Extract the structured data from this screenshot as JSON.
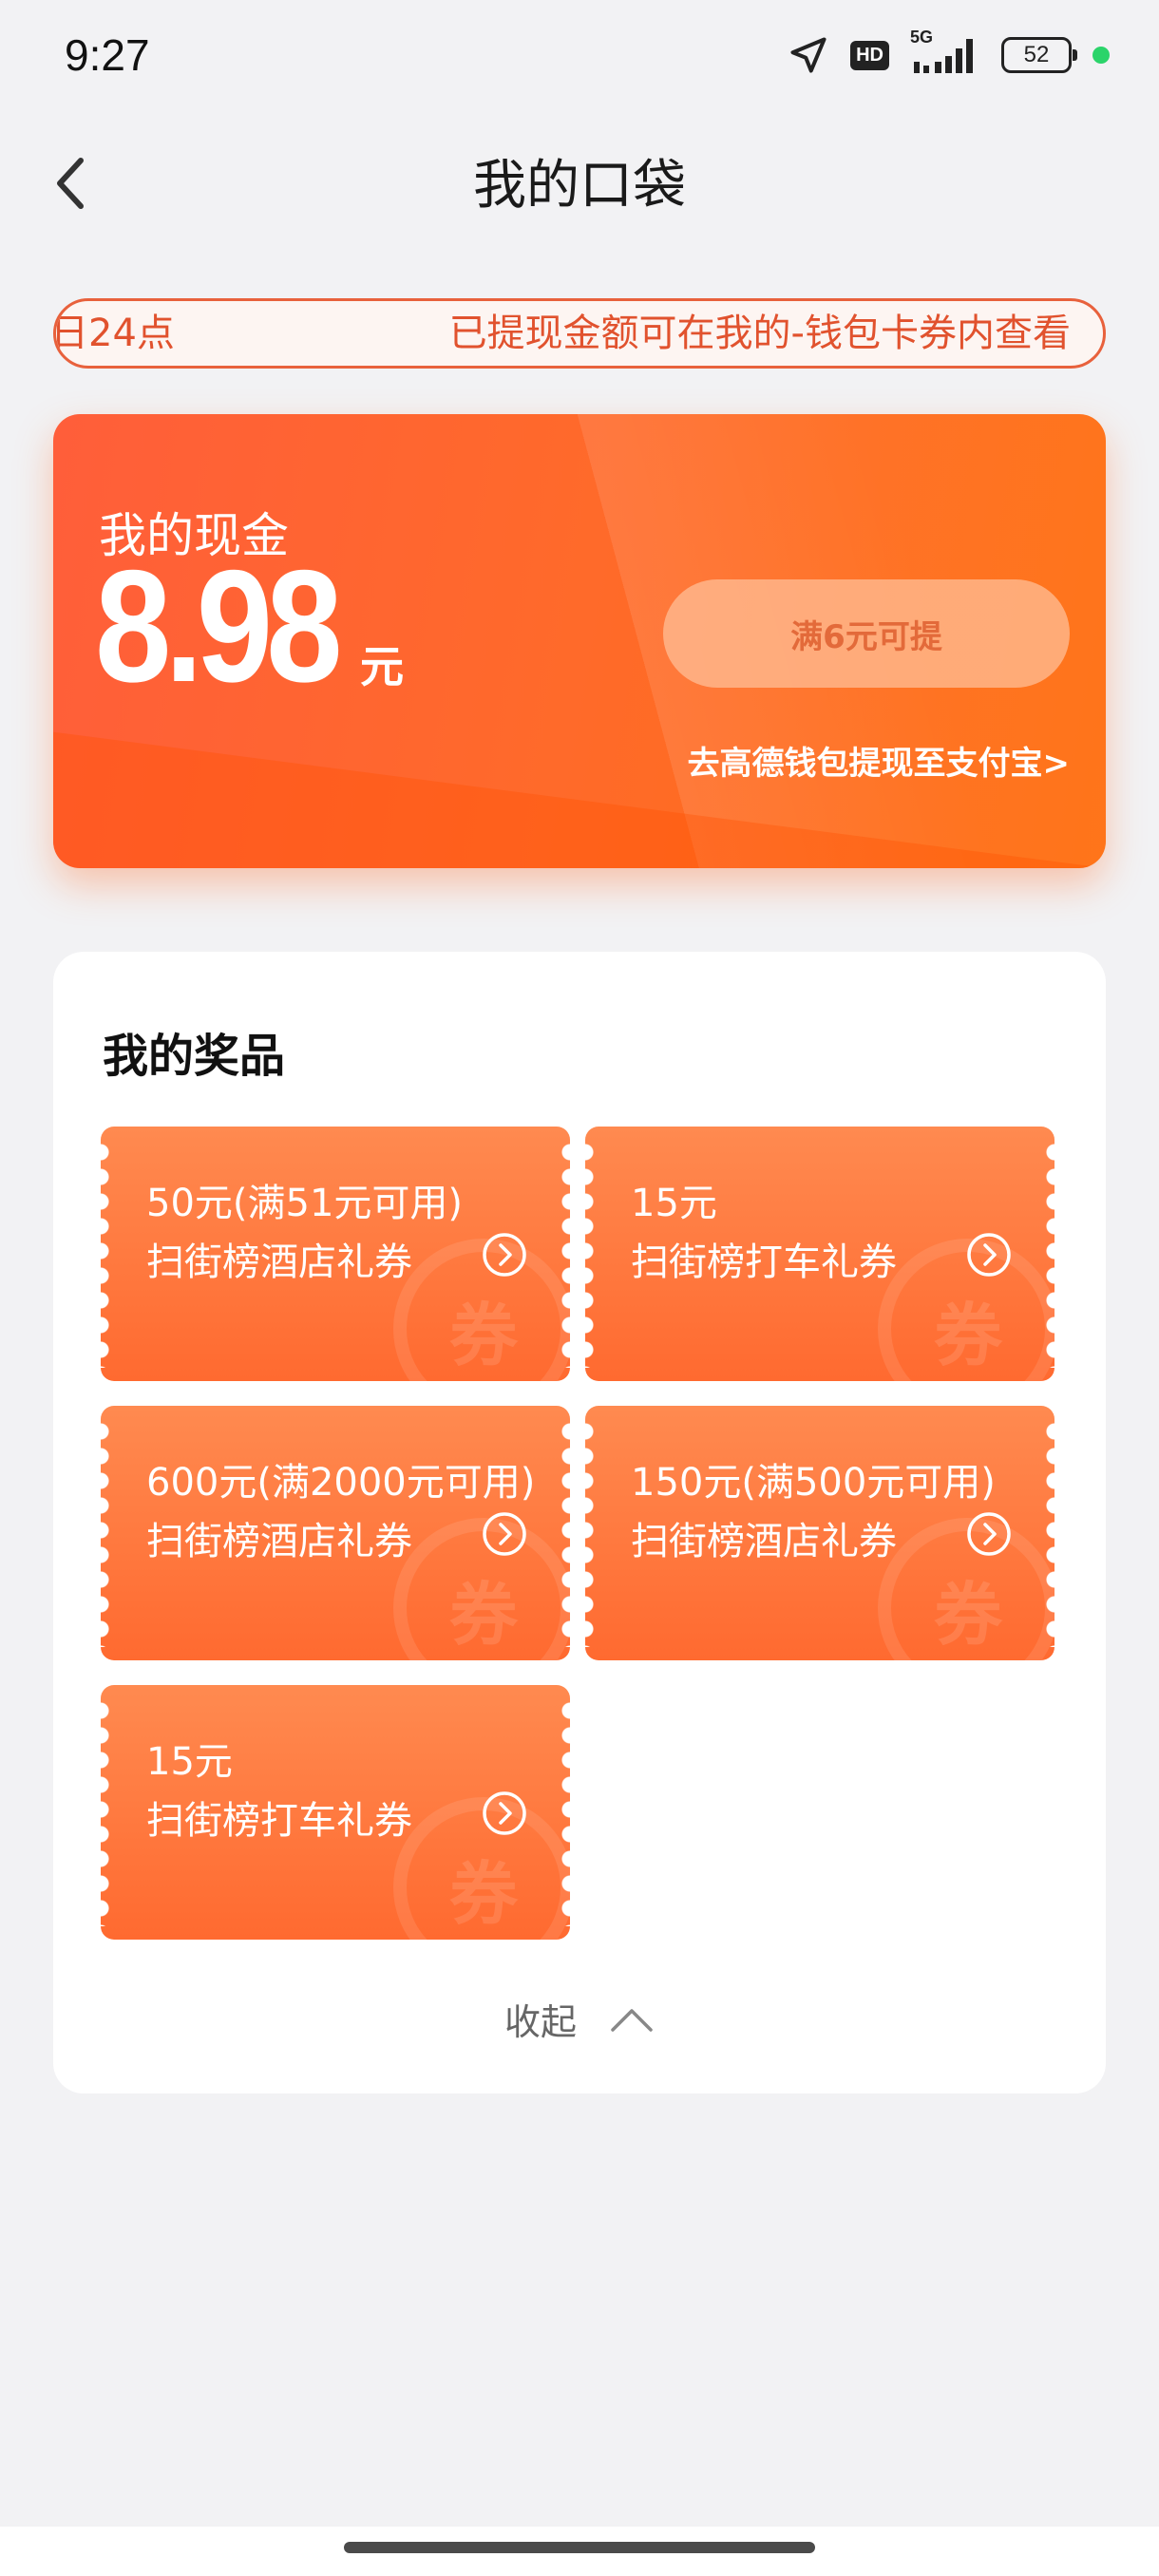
{
  "status_bar": {
    "time": "9:27",
    "network": "5G",
    "hd": "HD",
    "battery": "52",
    "icons": [
      "location-arrow-icon",
      "hd-badge-icon",
      "signal-icon",
      "battery-icon",
      "camera-dot-icon"
    ]
  },
  "nav": {
    "title": "我的口袋",
    "back_icon": "chevron-left-icon"
  },
  "notice": {
    "left_text": "日24点",
    "right_text": "已提现金额可在我的-钱包卡券内查看"
  },
  "cash": {
    "label": "我的现金",
    "amount": "8.98",
    "unit": "元",
    "button_label": "满6元可提",
    "link_label": "去高德钱包提现至支付宝>"
  },
  "prizes": {
    "title": "我的奖品",
    "coupons": [
      {
        "amount": "50元(满51元可用)",
        "name": "扫街榜酒店礼券",
        "watermark": "券"
      },
      {
        "amount": "15元",
        "name": "扫街榜打车礼券",
        "watermark": "券"
      },
      {
        "amount": "600元(满2000元可用)",
        "name": "扫街榜酒店礼券",
        "watermark": "券"
      },
      {
        "amount": "150元(满500元可用)",
        "name": "扫街榜酒店礼券",
        "watermark": "券"
      },
      {
        "amount": "15元",
        "name": "扫街榜打车礼券",
        "watermark": "券"
      }
    ],
    "collapse_label": "收起"
  },
  "colors": {
    "accent": "#ff6a2a",
    "notice_border": "#e8613c",
    "background": "#f2f2f4"
  }
}
